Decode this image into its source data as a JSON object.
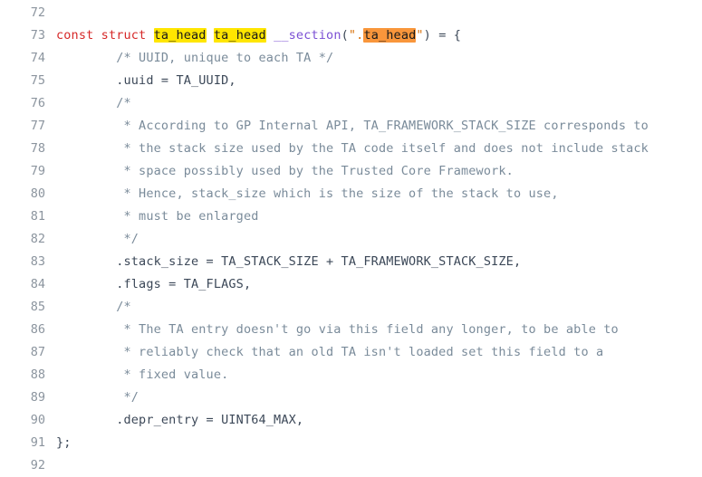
{
  "viewer": {
    "name": "code-listing",
    "background": "#ffffff",
    "first_line_number": 72,
    "last_line_number": 92,
    "colors": {
      "line_number": "#8b949e",
      "default_text": "#3c4858",
      "comment": "#7a8b9a",
      "keyword": "#d62828",
      "macro": "#7b4fd4",
      "string": "#d9730d",
      "highlight_current": "#ffe600",
      "highlight_match": "#f9963b"
    }
  },
  "lines": [
    {
      "number": "72",
      "tokens": [
        {
          "text": "",
          "style": "plain"
        }
      ]
    },
    {
      "number": "73",
      "tokens": [
        {
          "text": "const",
          "style": "keyword"
        },
        {
          "text": " ",
          "style": "plain"
        },
        {
          "text": "struct",
          "style": "keyword"
        },
        {
          "text": " ",
          "style": "plain"
        },
        {
          "text": "ta_head",
          "style": "plain",
          "highlight": "yellow"
        },
        {
          "text": " ",
          "style": "plain"
        },
        {
          "text": "ta_head",
          "style": "plain",
          "highlight": "yellow"
        },
        {
          "text": " ",
          "style": "plain"
        },
        {
          "text": "__section",
          "style": "macro"
        },
        {
          "text": "(",
          "style": "punct"
        },
        {
          "text": "\".",
          "style": "string"
        },
        {
          "text": "ta_head",
          "style": "string",
          "highlight": "orange"
        },
        {
          "text": "\"",
          "style": "string"
        },
        {
          "text": ")",
          "style": "punct"
        },
        {
          "text": " = {",
          "style": "plain"
        }
      ]
    },
    {
      "number": "74",
      "tokens": [
        {
          "text": "        /* UUID, unique to each TA */",
          "style": "comment"
        }
      ]
    },
    {
      "number": "75",
      "tokens": [
        {
          "text": "        .uuid = TA_UUID,",
          "style": "plain"
        }
      ]
    },
    {
      "number": "76",
      "tokens": [
        {
          "text": "        /*",
          "style": "comment"
        }
      ]
    },
    {
      "number": "77",
      "tokens": [
        {
          "text": "         * According to GP Internal API, TA_FRAMEWORK_STACK_SIZE corresponds to",
          "style": "comment"
        }
      ]
    },
    {
      "number": "78",
      "tokens": [
        {
          "text": "         * the stack size used by the TA code itself and does not include stack",
          "style": "comment"
        }
      ]
    },
    {
      "number": "79",
      "tokens": [
        {
          "text": "         * space possibly used by the Trusted Core Framework.",
          "style": "comment"
        }
      ]
    },
    {
      "number": "80",
      "tokens": [
        {
          "text": "         * Hence, stack_size which is the size of the stack to use,",
          "style": "comment"
        }
      ]
    },
    {
      "number": "81",
      "tokens": [
        {
          "text": "         * must be enlarged",
          "style": "comment"
        }
      ]
    },
    {
      "number": "82",
      "tokens": [
        {
          "text": "         */",
          "style": "comment"
        }
      ]
    },
    {
      "number": "83",
      "tokens": [
        {
          "text": "        .stack_size = TA_STACK_SIZE + TA_FRAMEWORK_STACK_SIZE,",
          "style": "plain"
        }
      ]
    },
    {
      "number": "84",
      "tokens": [
        {
          "text": "        .flags = TA_FLAGS,",
          "style": "plain"
        }
      ]
    },
    {
      "number": "85",
      "tokens": [
        {
          "text": "        /*",
          "style": "comment"
        }
      ]
    },
    {
      "number": "86",
      "tokens": [
        {
          "text": "         * The TA entry doesn't go via this field any longer, to be able to",
          "style": "comment"
        }
      ]
    },
    {
      "number": "87",
      "tokens": [
        {
          "text": "         * reliably check that an old TA isn't loaded set this field to a",
          "style": "comment"
        }
      ]
    },
    {
      "number": "88",
      "tokens": [
        {
          "text": "         * fixed value.",
          "style": "comment"
        }
      ]
    },
    {
      "number": "89",
      "tokens": [
        {
          "text": "         */",
          "style": "comment"
        }
      ]
    },
    {
      "number": "90",
      "tokens": [
        {
          "text": "        .depr_entry = UINT64_MAX,",
          "style": "plain"
        }
      ]
    },
    {
      "number": "91",
      "tokens": [
        {
          "text": "};",
          "style": "plain"
        }
      ]
    },
    {
      "number": "92",
      "tokens": [
        {
          "text": "",
          "style": "plain"
        }
      ]
    }
  ]
}
